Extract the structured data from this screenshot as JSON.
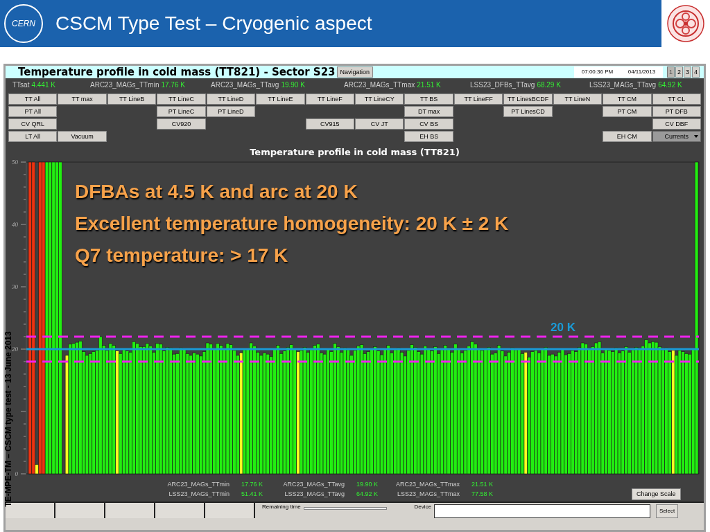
{
  "slide": {
    "logo_text": "CERN",
    "title": "CSCM Type Test – Cryogenic aspect",
    "side_note": "TE-MPE-TM – CSCM type test - 13 June 2013",
    "callouts": [
      "DFBAs at 4.5 K and arc at 20 K",
      "Excellent temperature homogeneity: 20 K ± 2 K",
      "Q7 temperature: > 17 K"
    ]
  },
  "window": {
    "title": "Temperature profile in cold mass (TT821) - Sector S23",
    "navigation_button": "Navigation",
    "time": "07:00:36 PM",
    "date": "04/11/2013",
    "pages": [
      {
        "label": "1",
        "selected": true
      },
      {
        "label": "2",
        "selected": false
      },
      {
        "label": "3",
        "selected": false
      },
      {
        "label": "4",
        "selected": false
      }
    ]
  },
  "readings": [
    {
      "label": "TTsat",
      "value": "4.441 K"
    },
    {
      "label": "ARC23_MAGs_TTmin",
      "value": "17.76 K"
    },
    {
      "label": "ARC23_MAGs_TTavg",
      "value": "19.90 K"
    },
    {
      "label": "ARC23_MAGs_TTmax",
      "value": "21.51 K"
    },
    {
      "label": "LSS23_DFBs_TTavg",
      "value": "68.29 K"
    },
    {
      "label": "LSS23_MAGs_TTavg",
      "value": "64.92 K"
    }
  ],
  "button_grid": [
    [
      {
        "label": "TT All",
        "kind": "button"
      },
      {
        "label": "TT max",
        "kind": "button"
      },
      {
        "label": "TT LineB",
        "kind": "button"
      },
      {
        "label": "TT LineC",
        "kind": "button"
      },
      {
        "label": "TT LineD",
        "kind": "button"
      },
      {
        "label": "TT LineE",
        "kind": "button"
      },
      {
        "label": "TT LineF",
        "kind": "button"
      },
      {
        "label": "TT LineCY",
        "kind": "button"
      },
      {
        "label": "TT BS",
        "kind": "button"
      },
      {
        "label": "TT LineFF",
        "kind": "button"
      },
      {
        "label": "TT LinesBCDF",
        "kind": "button"
      },
      {
        "label": "TT LineN",
        "kind": "button"
      },
      {
        "label": "TT CM",
        "kind": "button"
      },
      {
        "label": "TT CL",
        "kind": "button"
      }
    ],
    [
      {
        "label": "PT All",
        "kind": "button"
      },
      {
        "kind": "empty"
      },
      {
        "kind": "empty"
      },
      {
        "label": "PT LineC",
        "kind": "button"
      },
      {
        "label": "PT LineD",
        "kind": "button"
      },
      {
        "kind": "empty"
      },
      {
        "kind": "empty"
      },
      {
        "kind": "empty"
      },
      {
        "label": "DT max",
        "kind": "button"
      },
      {
        "kind": "empty"
      },
      {
        "label": "PT LinesCD",
        "kind": "button"
      },
      {
        "kind": "empty"
      },
      {
        "label": "PT CM",
        "kind": "button"
      },
      {
        "label": "PT DFB",
        "kind": "button"
      }
    ],
    [
      {
        "label": "CV QRL",
        "kind": "button"
      },
      {
        "kind": "empty"
      },
      {
        "kind": "empty"
      },
      {
        "label": "CV920",
        "kind": "button"
      },
      {
        "kind": "empty"
      },
      {
        "kind": "empty"
      },
      {
        "label": "CV915",
        "kind": "button"
      },
      {
        "label": "CV JT",
        "kind": "button"
      },
      {
        "label": "CV BS",
        "kind": "button"
      },
      {
        "kind": "empty"
      },
      {
        "kind": "empty"
      },
      {
        "kind": "empty"
      },
      {
        "kind": "empty"
      },
      {
        "label": "CV DBF",
        "kind": "button"
      }
    ],
    [
      {
        "label": "LT All",
        "kind": "button"
      },
      {
        "label": "Vacuum",
        "kind": "button"
      },
      {
        "kind": "empty"
      },
      {
        "kind": "empty"
      },
      {
        "kind": "empty"
      },
      {
        "kind": "empty"
      },
      {
        "kind": "empty"
      },
      {
        "kind": "empty"
      },
      {
        "label": "EH BS",
        "kind": "button"
      },
      {
        "kind": "empty"
      },
      {
        "kind": "empty"
      },
      {
        "kind": "empty"
      },
      {
        "label": "EH CM",
        "kind": "button"
      },
      {
        "label": "Currents",
        "kind": "dropdown"
      }
    ]
  ],
  "chart": {
    "chart_data": {
      "type": "bar",
      "title": "Temperature profile in cold mass (TT821)",
      "ylim": [
        0,
        50
      ],
      "yticks": [
        0,
        20,
        30,
        40,
        50
      ],
      "ref_lines": [
        {
          "axis": "y",
          "value": 22
        },
        {
          "axis": "y",
          "value": 20,
          "label": "20 K"
        },
        {
          "axis": "y",
          "value": 18
        }
      ],
      "series": [
        {
          "color": "#ee3311",
          "values": [
            50,
            50,
            null,
            50,
            50,
            null,
            null,
            null,
            null,
            null,
            null,
            null,
            null,
            null,
            null,
            null,
            null,
            null,
            null,
            null,
            null,
            null,
            null,
            null,
            null,
            null,
            null,
            null,
            null,
            null,
            null,
            null,
            null,
            null,
            null,
            null,
            null,
            null,
            null,
            null,
            null,
            null,
            null,
            null,
            null,
            null,
            null,
            null,
            null,
            null,
            null,
            null,
            null,
            null,
            null,
            null,
            null,
            null,
            null,
            null,
            null,
            null,
            null,
            null,
            null,
            null,
            null,
            null,
            null,
            null,
            null,
            null,
            null,
            null,
            null,
            null,
            null,
            null,
            null,
            null,
            null,
            null,
            null,
            null,
            null,
            null,
            null,
            null,
            null,
            null,
            null,
            null,
            null,
            null,
            null,
            null,
            null,
            null,
            null,
            null,
            null,
            null,
            null,
            null,
            null,
            null,
            null,
            null,
            null,
            null,
            null,
            null,
            null,
            null,
            null,
            null,
            null,
            null,
            null,
            null,
            null,
            null,
            null,
            null,
            null,
            null,
            null,
            null,
            null,
            null,
            null,
            null,
            null,
            null,
            null,
            null,
            null,
            null,
            null,
            null,
            null,
            null,
            null,
            null,
            null,
            null,
            null,
            null,
            null,
            null,
            null,
            null,
            null,
            null,
            null,
            null,
            null,
            null,
            null,
            null,
            null,
            null,
            null,
            null,
            null,
            null,
            null,
            null,
            null,
            null,
            null,
            null,
            null,
            null,
            null,
            null,
            null,
            null,
            null,
            null,
            null,
            null,
            null,
            null,
            null,
            null,
            null,
            null,
            null,
            null,
            null,
            null,
            null,
            null,
            null,
            null,
            null,
            null,
            null,
            null
          ]
        },
        {
          "color": "#ffff22",
          "values": [
            null,
            null,
            1.5,
            null,
            null,
            null,
            null,
            null,
            null,
            null,
            null,
            19.0,
            null,
            null,
            null,
            null,
            null,
            null,
            null,
            null,
            null,
            null,
            null,
            null,
            null,
            null,
            19.7,
            null,
            null,
            null,
            null,
            null,
            null,
            null,
            null,
            null,
            null,
            null,
            null,
            null,
            null,
            null,
            null,
            null,
            null,
            null,
            null,
            null,
            null,
            null,
            null,
            null,
            null,
            null,
            null,
            null,
            null,
            null,
            null,
            null,
            null,
            null,
            null,
            19.4,
            null,
            null,
            null,
            null,
            null,
            null,
            null,
            null,
            null,
            null,
            null,
            null,
            null,
            null,
            null,
            null,
            19.6,
            null,
            null,
            null,
            null,
            null,
            null,
            null,
            null,
            null,
            null,
            null,
            null,
            null,
            null,
            null,
            null,
            null,
            null,
            null,
            null,
            null,
            null,
            null,
            null,
            null,
            null,
            null,
            null,
            null,
            null,
            null,
            null,
            null,
            null,
            null,
            null,
            null,
            null,
            null,
            null,
            null,
            null,
            null,
            null,
            null,
            null,
            null,
            null,
            null,
            null,
            null,
            null,
            null,
            null,
            null,
            null,
            null,
            null,
            null,
            null,
            null,
            null,
            null,
            null,
            null,
            null,
            null,
            19.5,
            null,
            null,
            null,
            null,
            null,
            null,
            null,
            null,
            null,
            null,
            null,
            null,
            null,
            null,
            null,
            null,
            null,
            null,
            null,
            null,
            null,
            null,
            null,
            null,
            null,
            null,
            null,
            null,
            null,
            null,
            null,
            null,
            null,
            null,
            null,
            null,
            null,
            null,
            null,
            null,
            null,
            null,
            null,
            19.8,
            null,
            null,
            null,
            null,
            null,
            null,
            null
          ]
        },
        {
          "color": "#22ee11",
          "values": [
            null,
            null,
            null,
            null,
            null,
            50,
            50,
            50,
            50,
            50,
            null,
            null,
            20.8,
            20.9,
            21.1,
            21.3,
            19.6,
            19.0,
            19.3,
            19.6,
            19.8,
            22.0,
            20.6,
            19.8,
            20.9,
            20.6,
            null,
            19.3,
            19.9,
            19.7,
            19.5,
            21.2,
            20.9,
            20.4,
            20.4,
            20.9,
            20.5,
            19.5,
            20.9,
            20.8,
            19.7,
            20.3,
            20.2,
            19.2,
            19.3,
            20.2,
            20.1,
            19.3,
            19.0,
            19.4,
            19.2,
            18.9,
            19.6,
            21.0,
            20.8,
            20.1,
            20.9,
            20.6,
            20.0,
            20.9,
            20.7,
            19.8,
            19.0,
            null,
            19.9,
            20.0,
            21.0,
            20.5,
            19.5,
            19.0,
            19.4,
            19.2,
            18.8,
            20.1,
            20.6,
            19.3,
            19.7,
            20.3,
            20.7,
            20.0,
            null,
            19.8,
            20.3,
            19.5,
            19.9,
            20.6,
            20.8,
            19.4,
            19.2,
            20.1,
            19.6,
            20.9,
            20.4,
            19.5,
            20.2,
            19.9,
            19.0,
            19.8,
            20.5,
            20.7,
            19.3,
            19.6,
            20.1,
            20.4,
            19.7,
            19.1,
            20.0,
            20.6,
            19.4,
            19.9,
            20.2,
            19.5,
            18.9,
            19.8,
            20.7,
            20.3,
            19.6,
            19.2,
            20.5,
            20.0,
            19.7,
            20.4,
            19.3,
            19.9,
            20.6,
            20.2,
            19.5,
            20.8,
            20.1,
            19.4,
            19.8,
            20.5,
            21.2,
            20.8,
            20.0,
            19.8,
            20.1,
            20.3,
            19.2,
            19.4,
            20.6,
            19.7,
            18.9,
            19.5,
            20.2,
            19.9,
            20.0,
            19.3,
            null,
            18.7,
            19.6,
            19.8,
            19.4,
            20.1,
            20.3,
            19.0,
            19.2,
            18.9,
            19.5,
            20.0,
            19.1,
            19.3,
            19.8,
            19.6,
            20.3,
            21.0,
            20.8,
            20.1,
            20.4,
            21.0,
            21.2,
            19.4,
            20.0,
            19.8,
            19.6,
            20.2,
            19.4,
            19.7,
            20.4,
            19.5,
            19.9,
            20.3,
            20.0,
            20.5,
            21.5,
            21.0,
            21.2,
            21.1,
            20.4,
            19.9,
            20.2,
            19.6,
            null,
            19.0,
            19.8,
            19.6,
            19.3,
            19.2,
            20.0,
            50
          ]
        }
      ]
    }
  },
  "summary": [
    [
      {
        "label": "ARC23_MAGs_TTmin",
        "value": "17.76 K"
      },
      {
        "label": "ARC23_MAGs_TTavg",
        "value": "19.90 K"
      },
      {
        "label": "ARC23_MAGs_TTmax",
        "value": "21.51 K"
      }
    ],
    [
      {
        "label": "LSS23_MAGs_TTmin",
        "value": "51.41 K"
      },
      {
        "label": "LSS23_MAGs_TTavg",
        "value": "64.92 K"
      },
      {
        "label": "LSS23_MAGs_TTmax",
        "value": "77.58 K"
      }
    ]
  ],
  "change_scale_button": "Change Scale",
  "bottom_bar": {
    "buttons": [
      {
        "kind": "button"
      },
      {
        "kind": "button"
      },
      {
        "kind": "button"
      },
      {
        "kind": "button"
      },
      {
        "kind": "button"
      }
    ],
    "remaining": {
      "label": "Remaining time",
      "level": 0
    },
    "device_label": "Device",
    "select_button": "Select"
  }
}
